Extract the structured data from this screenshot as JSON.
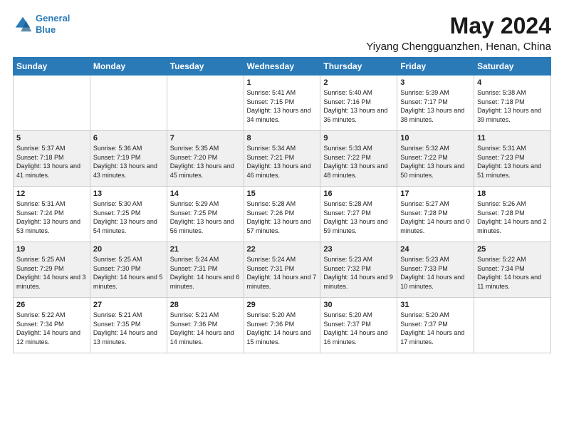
{
  "header": {
    "logo_line1": "General",
    "logo_line2": "Blue",
    "title": "May 2024",
    "subtitle": "Yiyang Chengguanzhen, Henan, China"
  },
  "days_of_week": [
    "Sunday",
    "Monday",
    "Tuesday",
    "Wednesday",
    "Thursday",
    "Friday",
    "Saturday"
  ],
  "weeks": [
    [
      {
        "day": "",
        "info": ""
      },
      {
        "day": "",
        "info": ""
      },
      {
        "day": "",
        "info": ""
      },
      {
        "day": "1",
        "info": "Sunrise: 5:41 AM\nSunset: 7:15 PM\nDaylight: 13 hours\nand 34 minutes."
      },
      {
        "day": "2",
        "info": "Sunrise: 5:40 AM\nSunset: 7:16 PM\nDaylight: 13 hours\nand 36 minutes."
      },
      {
        "day": "3",
        "info": "Sunrise: 5:39 AM\nSunset: 7:17 PM\nDaylight: 13 hours\nand 38 minutes."
      },
      {
        "day": "4",
        "info": "Sunrise: 5:38 AM\nSunset: 7:18 PM\nDaylight: 13 hours\nand 39 minutes."
      }
    ],
    [
      {
        "day": "5",
        "info": "Sunrise: 5:37 AM\nSunset: 7:18 PM\nDaylight: 13 hours\nand 41 minutes."
      },
      {
        "day": "6",
        "info": "Sunrise: 5:36 AM\nSunset: 7:19 PM\nDaylight: 13 hours\nand 43 minutes."
      },
      {
        "day": "7",
        "info": "Sunrise: 5:35 AM\nSunset: 7:20 PM\nDaylight: 13 hours\nand 45 minutes."
      },
      {
        "day": "8",
        "info": "Sunrise: 5:34 AM\nSunset: 7:21 PM\nDaylight: 13 hours\nand 46 minutes."
      },
      {
        "day": "9",
        "info": "Sunrise: 5:33 AM\nSunset: 7:22 PM\nDaylight: 13 hours\nand 48 minutes."
      },
      {
        "day": "10",
        "info": "Sunrise: 5:32 AM\nSunset: 7:22 PM\nDaylight: 13 hours\nand 50 minutes."
      },
      {
        "day": "11",
        "info": "Sunrise: 5:31 AM\nSunset: 7:23 PM\nDaylight: 13 hours\nand 51 minutes."
      }
    ],
    [
      {
        "day": "12",
        "info": "Sunrise: 5:31 AM\nSunset: 7:24 PM\nDaylight: 13 hours\nand 53 minutes."
      },
      {
        "day": "13",
        "info": "Sunrise: 5:30 AM\nSunset: 7:25 PM\nDaylight: 13 hours\nand 54 minutes."
      },
      {
        "day": "14",
        "info": "Sunrise: 5:29 AM\nSunset: 7:25 PM\nDaylight: 13 hours\nand 56 minutes."
      },
      {
        "day": "15",
        "info": "Sunrise: 5:28 AM\nSunset: 7:26 PM\nDaylight: 13 hours\nand 57 minutes."
      },
      {
        "day": "16",
        "info": "Sunrise: 5:28 AM\nSunset: 7:27 PM\nDaylight: 13 hours\nand 59 minutes."
      },
      {
        "day": "17",
        "info": "Sunrise: 5:27 AM\nSunset: 7:28 PM\nDaylight: 14 hours\nand 0 minutes."
      },
      {
        "day": "18",
        "info": "Sunrise: 5:26 AM\nSunset: 7:28 PM\nDaylight: 14 hours\nand 2 minutes."
      }
    ],
    [
      {
        "day": "19",
        "info": "Sunrise: 5:25 AM\nSunset: 7:29 PM\nDaylight: 14 hours\nand 3 minutes."
      },
      {
        "day": "20",
        "info": "Sunrise: 5:25 AM\nSunset: 7:30 PM\nDaylight: 14 hours\nand 5 minutes."
      },
      {
        "day": "21",
        "info": "Sunrise: 5:24 AM\nSunset: 7:31 PM\nDaylight: 14 hours\nand 6 minutes."
      },
      {
        "day": "22",
        "info": "Sunrise: 5:24 AM\nSunset: 7:31 PM\nDaylight: 14 hours\nand 7 minutes."
      },
      {
        "day": "23",
        "info": "Sunrise: 5:23 AM\nSunset: 7:32 PM\nDaylight: 14 hours\nand 9 minutes."
      },
      {
        "day": "24",
        "info": "Sunrise: 5:23 AM\nSunset: 7:33 PM\nDaylight: 14 hours\nand 10 minutes."
      },
      {
        "day": "25",
        "info": "Sunrise: 5:22 AM\nSunset: 7:34 PM\nDaylight: 14 hours\nand 11 minutes."
      }
    ],
    [
      {
        "day": "26",
        "info": "Sunrise: 5:22 AM\nSunset: 7:34 PM\nDaylight: 14 hours\nand 12 minutes."
      },
      {
        "day": "27",
        "info": "Sunrise: 5:21 AM\nSunset: 7:35 PM\nDaylight: 14 hours\nand 13 minutes."
      },
      {
        "day": "28",
        "info": "Sunrise: 5:21 AM\nSunset: 7:36 PM\nDaylight: 14 hours\nand 14 minutes."
      },
      {
        "day": "29",
        "info": "Sunrise: 5:20 AM\nSunset: 7:36 PM\nDaylight: 14 hours\nand 15 minutes."
      },
      {
        "day": "30",
        "info": "Sunrise: 5:20 AM\nSunset: 7:37 PM\nDaylight: 14 hours\nand 16 minutes."
      },
      {
        "day": "31",
        "info": "Sunrise: 5:20 AM\nSunset: 7:37 PM\nDaylight: 14 hours\nand 17 minutes."
      },
      {
        "day": "",
        "info": ""
      }
    ]
  ]
}
